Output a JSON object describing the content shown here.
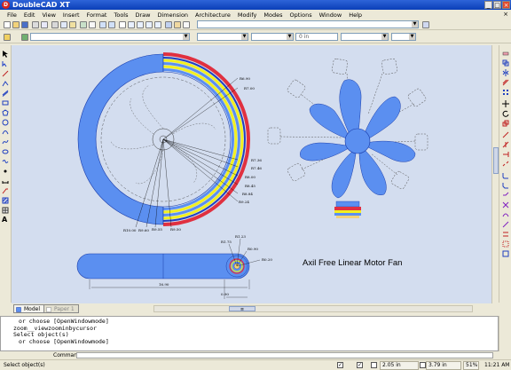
{
  "window": {
    "title": "DoubleCAD XT",
    "logo_letter": "D",
    "min_glyph": "_",
    "max_glyph": "□",
    "close_glyph": "×"
  },
  "menu": [
    "File",
    "Edit",
    "View",
    "Insert",
    "Format",
    "Tools",
    "Draw",
    "Dimension",
    "Architecture",
    "Modify",
    "Modes",
    "Options",
    "Window",
    "Help"
  ],
  "toolbar": {
    "snap_field_value": "0 in"
  },
  "drawing": {
    "heading": "Axil Free Linear Motor Fan",
    "top_right_labels": [
      "R6.90",
      "R7.00",
      "R7.36",
      "R7.46",
      "R8.00",
      "R8.45",
      "R8.84",
      "R9.24"
    ],
    "bottom_labels": [
      "R10.00",
      "R9.60",
      "R9.55",
      "R9.50"
    ],
    "side_labels": [
      "R1.75",
      "R1.23",
      "R0.90",
      "R0.20"
    ],
    "width_dimension": "16.90",
    "small_dimension": "0.90"
  },
  "tabs": [
    {
      "label": "Model",
      "active": true
    },
    {
      "label": "Paper 1",
      "active": false
    }
  ],
  "command_history": [
    "or choose [OpenWindowmode]",
    "zoom__viewzoominbycursor",
    "Select object(s)",
    "or choose [OpenWindowmode]"
  ],
  "command_prompt": "Command:",
  "status": {
    "message": "Select object(s)",
    "x_coord": "2.05 in",
    "y_coord": "3.79 in",
    "zoom": "51%",
    "time": "11:21 AM"
  },
  "colors": {
    "canvas": "#d3ddef",
    "part_fill": "#5b8ff0",
    "coil_yellow": "#f2f020",
    "coil_red": "#e03040",
    "title_bar": "#0a3fb8"
  }
}
